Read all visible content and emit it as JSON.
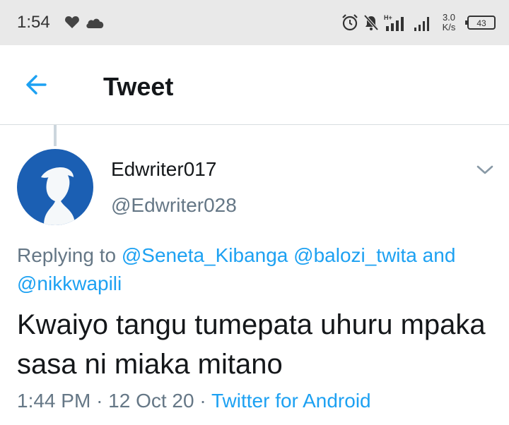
{
  "status_bar": {
    "time": "1:54",
    "network_label": "H+",
    "speed_value": "3.0",
    "speed_unit": "K/s",
    "battery": "43",
    "icons": [
      "heart-icon",
      "cloud-icon",
      "alarm-icon",
      "notifications-muted-icon",
      "signal-icon",
      "battery-icon"
    ]
  },
  "header": {
    "title": "Tweet",
    "back_icon": "arrow-left-icon"
  },
  "tweet": {
    "display_name": "Edwriter017",
    "handle": "@Edwriter028",
    "replying_prefix": "Replying to",
    "mentions": [
      "@Seneta_Kibanga",
      "@balozi_twita",
      "@nikkwapili"
    ],
    "mentions_joiner": "and",
    "text": "Kwaiyo tangu tumepata uhuru mpaka sasa ni miaka mitano",
    "time": "1:44 PM",
    "separator": "·",
    "date": "12 Oct 20",
    "source": "Twitter for Android"
  },
  "colors": {
    "accent": "#1da1f2",
    "avatar_bg": "#1b5fb3",
    "muted_text": "#657786",
    "primary_text": "#14171a",
    "status_bar_bg": "#e9e9e9"
  }
}
